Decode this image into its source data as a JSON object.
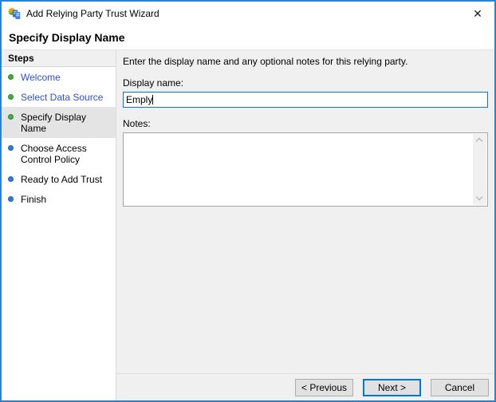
{
  "window": {
    "title": "Add Relying Party Trust Wizard"
  },
  "icons": {
    "close": "✕",
    "app": "adfs-wizard-icon",
    "scroll_up": "chevron-up",
    "scroll_down": "chevron-down"
  },
  "page": {
    "heading": "Specify Display Name"
  },
  "sidebar": {
    "header": "Steps",
    "items": [
      {
        "label": "Welcome",
        "state": "completed"
      },
      {
        "label": "Select Data Source",
        "state": "completed"
      },
      {
        "label": "Specify Display Name",
        "state": "current"
      },
      {
        "label": "Choose Access Control Policy",
        "state": "upcoming"
      },
      {
        "label": "Ready to Add Trust",
        "state": "upcoming"
      },
      {
        "label": "Finish",
        "state": "upcoming"
      }
    ]
  },
  "main": {
    "description": "Enter the display name and any optional notes for this relying party.",
    "display_name": {
      "label": "Display name:",
      "value": "Emply"
    },
    "notes": {
      "label": "Notes:",
      "value": ""
    }
  },
  "buttons": {
    "previous": "< Previous",
    "next": "Next >",
    "cancel": "Cancel"
  },
  "colors": {
    "accent": "#0078d7",
    "window_border": "#2a82d4",
    "completed_bullet": "#46a846",
    "upcoming_bullet": "#2e7bd9",
    "link_text": "#3050c8",
    "content_background": "#f0f0f0"
  }
}
